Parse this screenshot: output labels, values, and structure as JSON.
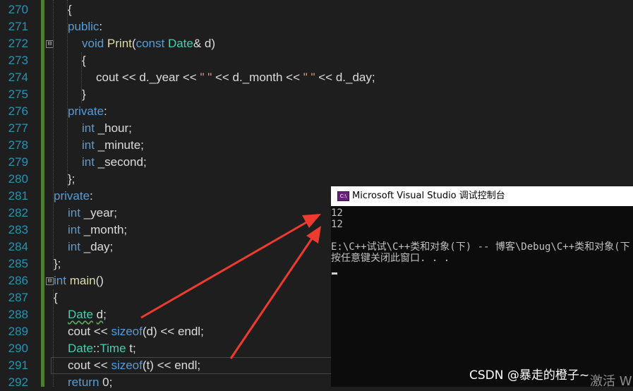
{
  "editor": {
    "line_numbers": [
      "270",
      "271",
      "272",
      "273",
      "274",
      "275",
      "276",
      "277",
      "278",
      "279",
      "280",
      "281",
      "282",
      "283",
      "284",
      "285",
      "286",
      "287",
      "288",
      "289",
      "290",
      "291",
      "292"
    ],
    "lines": [
      [
        "{"
      ],
      [
        "public",
        ":"
      ],
      [
        "void",
        "Print",
        "(",
        "const",
        "Date",
        "& d)"
      ],
      [
        "{"
      ],
      [
        "cout << d._year << ",
        "\" \"",
        " << d._month << ",
        "\" \"",
        " << d._day;"
      ],
      [
        "}"
      ],
      [
        "private",
        ":"
      ],
      [
        "int",
        " _hour;"
      ],
      [
        "int",
        " _minute;"
      ],
      [
        "int",
        " _second;"
      ],
      [
        "};"
      ],
      [
        "private",
        ":"
      ],
      [
        "int",
        " _year;"
      ],
      [
        "int",
        " _month;"
      ],
      [
        "int",
        " _day;"
      ],
      [
        "};"
      ],
      [
        "int",
        " ",
        "main",
        "()"
      ],
      [
        "{"
      ],
      [
        "Date",
        " ",
        "d",
        ";"
      ],
      [
        "cout << ",
        "sizeof",
        "(d) << endl;"
      ],
      [
        "Date",
        "::",
        "Time",
        " ",
        "t",
        ";"
      ],
      [
        "cout << ",
        "sizeof",
        "(t) << endl;"
      ],
      [
        "return",
        " 0;"
      ]
    ],
    "fold_markers": [
      "⊟",
      "⊟"
    ]
  },
  "console": {
    "title": "Microsoft Visual Studio 调试控制台",
    "icon_label": "C:\\",
    "output": [
      "12",
      "12",
      "",
      "E:\\C++试试\\C++类和对象(下) -- 博客\\Debug\\C++类和对象(下",
      "按任意键关闭此窗口. . ."
    ]
  },
  "watermark": "CSDN @暴走的橙子~",
  "activate_text": "激活 W",
  "colors": {
    "editor_background": "#1e1e1e",
    "keyword": "#569cd6",
    "type": "#4ec9b0",
    "function": "#dcdcaa",
    "string": "#d69d85",
    "line_number": "#2b91af",
    "console_background": "#0c0c0c",
    "arrow": "#ee3b2f"
  }
}
